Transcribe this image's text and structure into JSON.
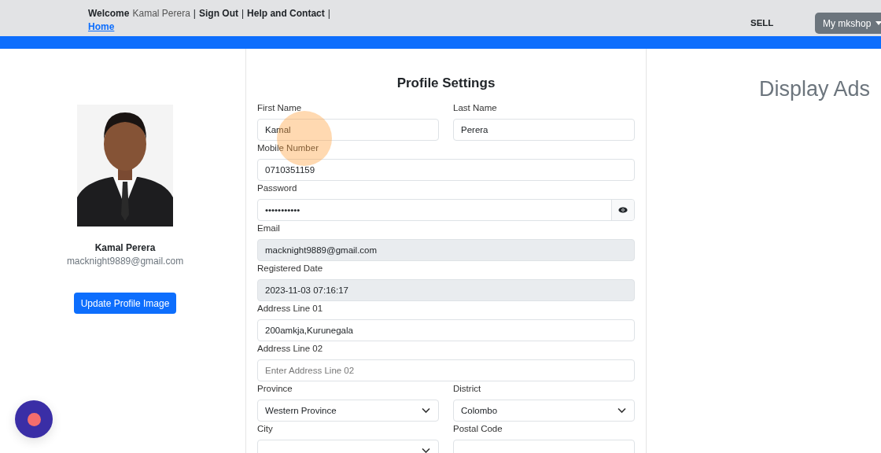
{
  "header": {
    "segments": [
      {
        "kind": "bold",
        "text": "Welcome"
      },
      {
        "kind": "plain",
        "text": "Kamal Perera"
      },
      {
        "kind": "sep",
        "text": "|"
      },
      {
        "kind": "action",
        "text": "Sign Out"
      },
      {
        "kind": "sep",
        "text": "|"
      },
      {
        "kind": "action",
        "text": "Help and Contact"
      },
      {
        "kind": "sep",
        "text": "|"
      },
      {
        "kind": "link",
        "text": "Home"
      }
    ],
    "sell": "SELL",
    "shop_menu": "My mkshop"
  },
  "profile": {
    "name": "Kamal Perera",
    "email": "macknight9889@gmail.com",
    "button": "Update Profile Image"
  },
  "form": {
    "title": "Profile Settings",
    "rows": [
      [
        {
          "kind": "text",
          "label": "First Name",
          "value": "Kamal"
        },
        {
          "kind": "text",
          "label": "Last Name",
          "value": "Perera"
        }
      ],
      [
        {
          "kind": "text",
          "label": "Mobile Number",
          "value": "0710351159"
        }
      ],
      [
        {
          "kind": "password",
          "label": "Password",
          "value": "•••••••••••"
        }
      ],
      [
        {
          "kind": "readonly",
          "label": "Email",
          "value": "macknight9889@gmail.com"
        }
      ],
      [
        {
          "kind": "readonly",
          "label": "Registered Date",
          "value": "2023-11-03 07:16:17"
        }
      ],
      [
        {
          "kind": "text",
          "label": "Address Line 01",
          "value": "200amkja,Kurunegala"
        }
      ],
      [
        {
          "kind": "text",
          "label": "Address Line 02",
          "placeholder": "Enter Address Line 02"
        }
      ],
      [
        {
          "kind": "select",
          "label": "Province",
          "value": "Western Province"
        },
        {
          "kind": "select",
          "label": "District",
          "value": "Colombo"
        }
      ],
      [
        {
          "kind": "select",
          "label": "City"
        },
        {
          "kind": "text",
          "label": "Postal Code"
        }
      ]
    ]
  },
  "ads": {
    "title": "Display Ads"
  }
}
